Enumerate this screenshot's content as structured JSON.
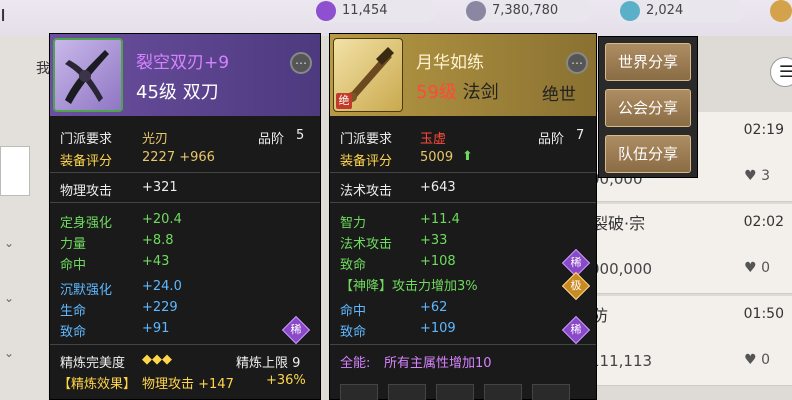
{
  "background": {
    "title_fragment": "ı",
    "tab_fragment": "我",
    "currencies": [
      {
        "icon": "feather-icon",
        "value": "11,454"
      },
      {
        "icon": "silver-coin-icon",
        "value": "7,380,780"
      },
      {
        "icon": "gem-icon",
        "value": "2,024"
      }
    ],
    "rows": [
      {
        "time": "02:19",
        "likes": "3",
        "amount": "00,000",
        "name": ""
      },
      {
        "time": "02:02",
        "likes": "0",
        "amount": "000,000",
        "name": "裂破·宗"
      },
      {
        "time": "01:50",
        "likes": "0",
        "amount": "111,113",
        "name": "防"
      }
    ]
  },
  "item1": {
    "name": "裂空双刃+9",
    "level_type": "45级 双刀",
    "sect_label": "门派要求",
    "sect_value": "光刃",
    "grade_label": "品阶",
    "grade_value": "5",
    "score_label": "装备评分",
    "score_value": "2227 +966",
    "base": [
      {
        "label": "物理攻击",
        "value": "+321"
      }
    ],
    "green": [
      {
        "label": "定身强化",
        "value": "+20.4"
      },
      {
        "label": "力量",
        "value": "+8.8"
      },
      {
        "label": "命中",
        "value": "+43"
      }
    ],
    "blue": [
      {
        "label": "沉默强化",
        "value": "+24.0"
      },
      {
        "label": "生命",
        "value": "+229"
      },
      {
        "label": "致命",
        "value": "+91"
      }
    ],
    "rare_badge": "稀",
    "refine_label": "精炼完美度",
    "refine_diamonds": "◆◆◆",
    "refine_limit": "精炼上限 9",
    "refine_effect_label": "【精炼效果】",
    "refine_effect": "物理攻击 +147",
    "refine_percent": "+36%"
  },
  "item2": {
    "name": "月华如练",
    "level": "59级",
    "type": "法剑",
    "jueshi": "绝世",
    "icon_badge": "绝",
    "sect_label": "门派要求",
    "sect_value": "玉虚",
    "grade_label": "品阶",
    "grade_value": "7",
    "score_label": "装备评分",
    "score_value": "5009",
    "base": [
      {
        "label": "法术攻击",
        "value": "+643"
      }
    ],
    "green": [
      {
        "label": "智力",
        "value": "+11.4"
      },
      {
        "label": "法术攻击",
        "value": "+33"
      },
      {
        "label": "致命",
        "value": "+108"
      }
    ],
    "shenjiang": "【神降】攻击力增加3%",
    "blue": [
      {
        "label": "命中",
        "value": "+62"
      },
      {
        "label": "致命",
        "value": "+109"
      }
    ],
    "rare_badge": "稀",
    "extreme_badge": "极",
    "allround_label": "全能:",
    "allround_value": "所有主属性增加10"
  },
  "share": {
    "world": "世界分享",
    "guild": "公会分享",
    "team": "队伍分享"
  }
}
